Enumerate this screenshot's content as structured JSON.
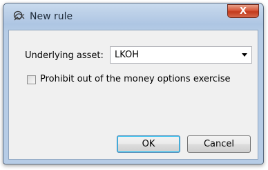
{
  "window": {
    "title": "New rule",
    "close_label": "X"
  },
  "form": {
    "asset_label": "Underlying asset:",
    "asset_value": "LKOH",
    "prohibit_label": "Prohibit out of the money options exercise",
    "prohibit_checked": false
  },
  "buttons": {
    "ok_label": "OK",
    "cancel_label": "Cancel"
  },
  "icons": {
    "app": "rule-icon",
    "close": "close-icon",
    "dropdown": "chevron-down-icon"
  }
}
